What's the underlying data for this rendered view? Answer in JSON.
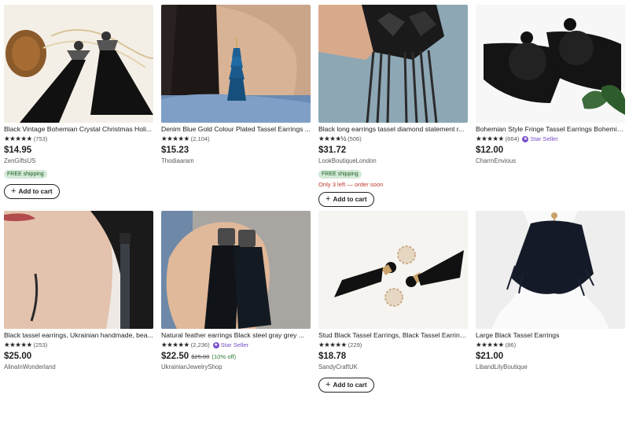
{
  "products": [
    {
      "title": "Black Vintage Bohemian Crystal Christmas Holi...",
      "stars": "★★★★★",
      "reviews": "(753)",
      "star_seller": "",
      "price": "$14.95",
      "original_price": "",
      "discount": "",
      "shop": "ZenGiftsUS",
      "badge": "FREE shipping",
      "stock": "",
      "cart_label": "Add to cart"
    },
    {
      "title": "Denim Blue Gold Colour Plated Tassel Earrings ...",
      "stars": "★★★★★",
      "reviews": "(2,104)",
      "star_seller": "",
      "price": "$15.23",
      "original_price": "",
      "discount": "",
      "shop": "Thodiaaram",
      "badge": "",
      "stock": "",
      "cart_label": ""
    },
    {
      "title": "Black long earrings tassel diamond statement r...",
      "stars": "★★★★½",
      "reviews": "(506)",
      "star_seller": "",
      "price": "$31.72",
      "original_price": "",
      "discount": "",
      "shop": "LookBoutiqueLondon",
      "badge": "FREE shipping",
      "stock": "Only 3 left — order soon",
      "cart_label": "Add to cart"
    },
    {
      "title": "Bohemian Style Fringe Tassel Earrings Bohemia...",
      "stars": "★★★★★",
      "reviews": "(664)",
      "star_seller": "Star Seller",
      "price": "$12.00",
      "original_price": "",
      "discount": "",
      "shop": "CharmEnvious",
      "badge": "",
      "stock": "",
      "cart_label": ""
    },
    {
      "title": "Black tassel earrings, Ukrainian handmade, bea...",
      "stars": "★★★★★",
      "reviews": "(253)",
      "star_seller": "",
      "price": "$25.00",
      "original_price": "",
      "discount": "",
      "shop": "AlinaInWonderland",
      "badge": "",
      "stock": "",
      "cart_label": ""
    },
    {
      "title": "Natural feather earrings Black steel gray grey ...",
      "stars": "★★★★★",
      "reviews": "(2,236)",
      "star_seller": "Star Seller",
      "price": "$22.50",
      "original_price": "$25.00",
      "discount": "(10% off)",
      "shop": "UkrainianJewelryShop",
      "badge": "",
      "stock": "",
      "cart_label": ""
    },
    {
      "title": "Stud Black Tassel Earrings, Black Tassel Earring...",
      "stars": "★★★★★",
      "reviews": "(229)",
      "star_seller": "",
      "price": "$18.78",
      "original_price": "",
      "discount": "",
      "shop": "SandyCraftUK",
      "badge": "",
      "stock": "",
      "cart_label": "Add to cart"
    },
    {
      "title": "Large Black Tassel Earrings",
      "stars": "★★★★★",
      "reviews": "(86)",
      "star_seller": "",
      "price": "$21.00",
      "original_price": "",
      "discount": "",
      "shop": "LibandLilyBoutique",
      "badge": "",
      "stock": "",
      "cart_label": ""
    }
  ],
  "colors": {
    "price": "#222222",
    "star_seller": "#7a4fc7",
    "free_shipping_bg": "#d4e9d7",
    "stock_warning": "#c0392b",
    "discount": "#2e7d32"
  }
}
